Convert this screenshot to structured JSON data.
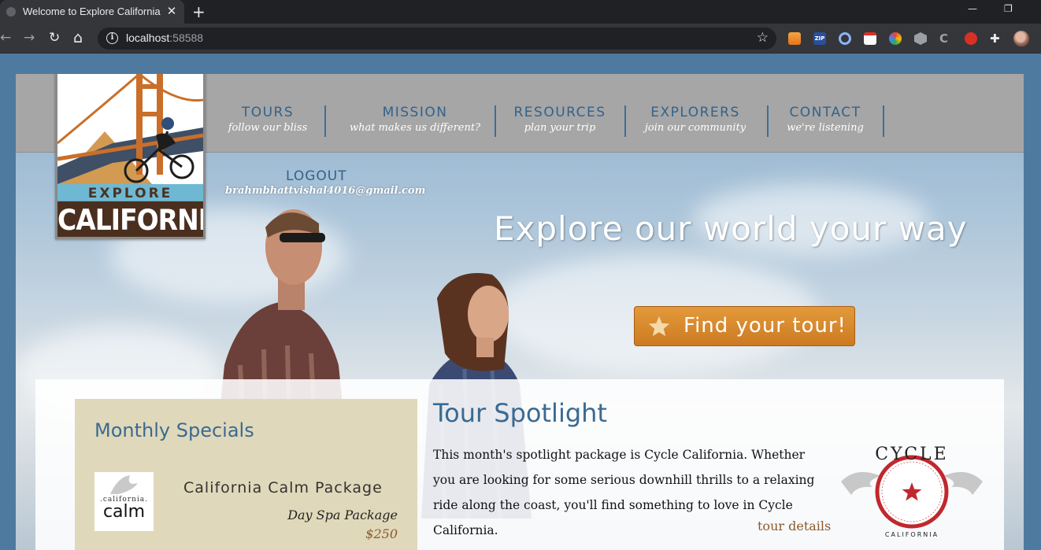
{
  "browser": {
    "tab_title": "Welcome to Explore California",
    "tab_close": "✕",
    "new_tab": "+",
    "minimize": "—",
    "restore": "❐",
    "url_host": "localhost",
    "url_port": ":58588",
    "back": "←",
    "forward": "→",
    "reload": "↻",
    "home": "⌂",
    "info_glyph": "i",
    "bookmark_star": "☆",
    "extension_icons": [
      "stack-ext-icon",
      "zip-ext-icon",
      "circle-ext-icon",
      "docs-ext-icon",
      "color-wheel-ext-icon",
      "hex-ext-icon",
      "c-ext-icon",
      "hand-ext-icon",
      "puzzle-icon",
      "profile-avatar"
    ]
  },
  "nav": [
    {
      "title": "TOURS",
      "sub": "follow our bliss"
    },
    {
      "title": "MISSION",
      "sub": "what makes us different?"
    },
    {
      "title": "RESOURCES",
      "sub": "plan your trip"
    },
    {
      "title": "EXPLORERS",
      "sub": "join our community"
    },
    {
      "title": "CONTACT",
      "sub": "we're listening"
    }
  ],
  "logo": {
    "explore": "EXPLORE",
    "california": "CALIFORNIA"
  },
  "user": {
    "logout": "LOGOUT",
    "email": "brahmbhattvishal4016@gmail.com"
  },
  "hero": {
    "title": "Explore our world your way",
    "button": "Find your tour!"
  },
  "specials": {
    "title": "Monthly Specials",
    "logo_small": ".california.",
    "logo_big": "calm",
    "package_name": "California Calm Package",
    "package_type": "Day Spa Package",
    "price": "$250"
  },
  "spotlight": {
    "title": "Tour Spotlight",
    "body": "This month's spotlight package is Cycle California. Whether you are looking for some serious downhill thrills to a relaxing ride along the coast, you'll find something to love in Cycle California.",
    "link": "tour details",
    "logo_top": "CYCLE",
    "logo_bottom": "CALIFORNIA"
  },
  "colors": {
    "nav_blue": "#33628a",
    "button_orange": "#d98a2e",
    "specials_bg": "#e0d8ba",
    "price_brown": "#8a5a2e"
  }
}
